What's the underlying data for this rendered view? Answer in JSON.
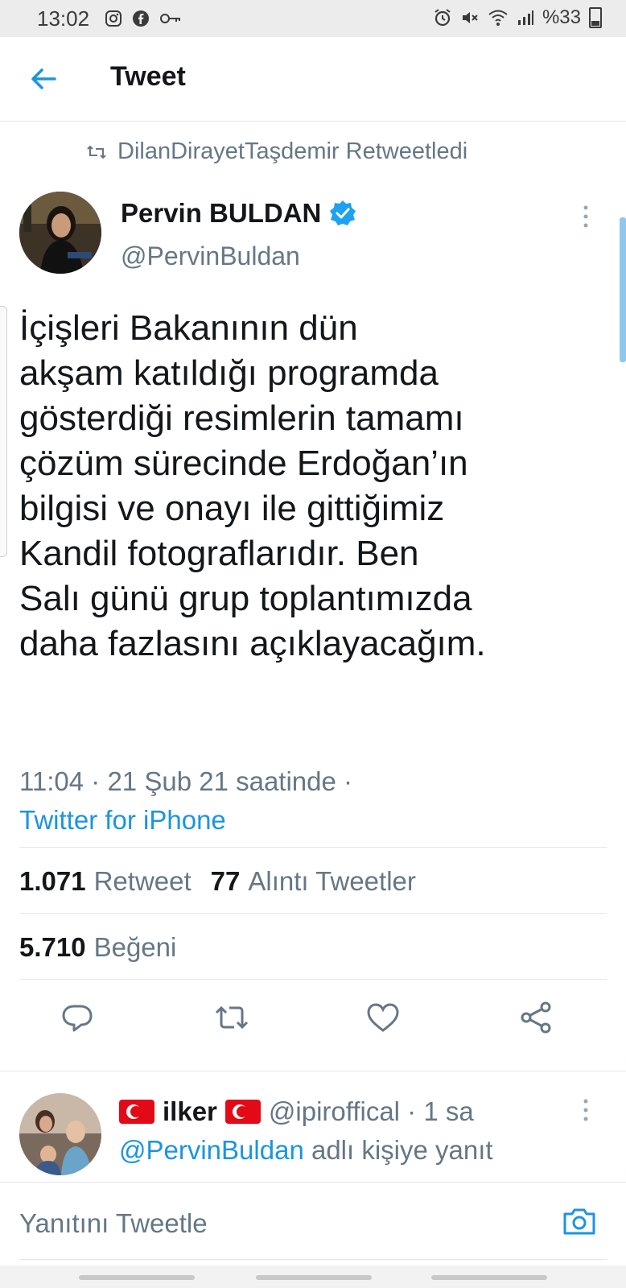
{
  "status_bar": {
    "time": "13:02",
    "left_icons": [
      "instagram-icon",
      "facebook-icon",
      "key-icon"
    ],
    "right_icons": [
      "alarm-icon",
      "mute-icon",
      "wifi-icon",
      "signal-icon"
    ],
    "battery": "%33"
  },
  "header": {
    "title": "Tweet"
  },
  "retweet": {
    "text": "DilanDirayetTaşdemir Retweetledi"
  },
  "tweet": {
    "author_name": "Pervin BULDAN",
    "author_handle": "@PervinBuldan",
    "text": "İçişleri Bakanının dün\nakşam katıldığı programda\ngösterdiği resimlerin tamamı\nçözüm sürecinde Erdoğan’ın\nbilgisi ve onayı ile gittiğimiz\nKandil fotograflarıdır. Ben\nSalı günü grup toplantımızda\ndaha fazlasını açıklayacağım.",
    "timestamp": "11:04 · 21 Şub 21 saatinde ·",
    "source": "Twitter for iPhone"
  },
  "stats": {
    "retweets_count": "1.071",
    "retweets_label": "Retweet",
    "quotes_count": "77",
    "quotes_label": "Alıntı Tweetler",
    "likes_count": "5.710",
    "likes_label": "Beğeni"
  },
  "actions": [
    "reply-icon",
    "retweet-icon",
    "like-icon",
    "share-icon"
  ],
  "reply": {
    "name": "ilker",
    "handle_time": "@ipiroffical · 1 sa",
    "context_mention": "@PervinBuldan",
    "context_text": " adlı kişiye yanıt"
  },
  "composer": {
    "placeholder": "Yanıtını Tweetle"
  },
  "colors": {
    "accent": "#1b95e0",
    "secondary_text": "#657786",
    "primary_text": "#14171a",
    "divider": "#e1e8ed"
  }
}
